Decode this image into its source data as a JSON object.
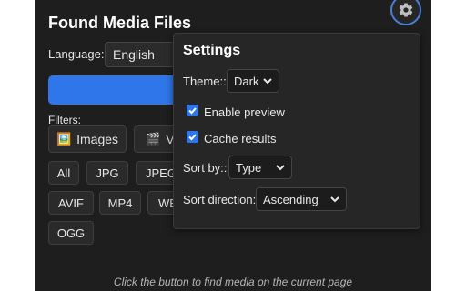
{
  "header": {
    "title": "Found Media Files"
  },
  "language": {
    "label": "Language:",
    "selected": "English"
  },
  "filters": {
    "label": "Filters:",
    "categories": [
      {
        "label": "Images",
        "icon": "framed-picture-icon"
      },
      {
        "label": "Vi",
        "icon": "clapper-board-icon"
      }
    ],
    "formats": [
      "All",
      "JPG",
      "JPEG",
      "AVIF",
      "MP4",
      "WE",
      "OGG"
    ]
  },
  "footer": {
    "hint": "Click the button to find media on the current page"
  },
  "settings": {
    "title": "Settings",
    "theme_label": "Theme::",
    "theme_value": "Dark",
    "enable_preview_label": "Enable preview",
    "enable_preview_checked": true,
    "cache_results_label": "Cache results",
    "cache_results_checked": true,
    "sort_by_label": "Sort by::",
    "sort_by_value": "Type",
    "sort_direction_label": "Sort direction::",
    "sort_direction_value": "Ascending"
  },
  "colors": {
    "panel_bg": "#1e1e1e",
    "accent": "#2f76ea",
    "popup_bg": "#262626"
  }
}
